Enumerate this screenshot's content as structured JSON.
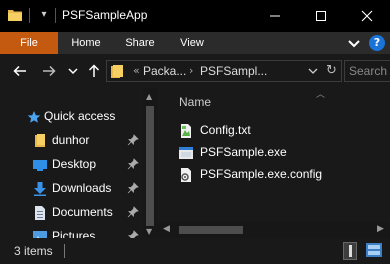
{
  "window": {
    "title": "PSFSampleApp",
    "minimize_icon": "minimize-icon",
    "maximize_icon": "maximize-icon",
    "close_icon": "close-icon"
  },
  "ribbon": {
    "tabs": [
      "File",
      "Home",
      "Share",
      "View"
    ],
    "file_tab_color": "#c45a0f",
    "help_label": "?"
  },
  "navigation": {
    "back_icon": "arrow-left-icon",
    "forward_icon": "arrow-right-icon",
    "recent_icon": "chevron-down-icon",
    "up_icon": "arrow-up-icon"
  },
  "address": {
    "overflow": "«",
    "crumbs": [
      "Packa...",
      "PSFSampl..."
    ],
    "separator": "›"
  },
  "search": {
    "placeholder": "Search"
  },
  "sidebar": {
    "items": [
      {
        "label": "Quick access",
        "icon": "star-icon"
      },
      {
        "label": "dunhor",
        "icon": "folder-icon",
        "pinned": true
      },
      {
        "label": "Desktop",
        "icon": "desktop-icon",
        "pinned": true
      },
      {
        "label": "Downloads",
        "icon": "download-icon",
        "pinned": true
      },
      {
        "label": "Documents",
        "icon": "document-icon",
        "pinned": true
      },
      {
        "label": "Pictures",
        "icon": "pictures-icon",
        "pinned": true
      }
    ]
  },
  "content": {
    "column_header": "Name",
    "files": [
      {
        "name": "Config.txt",
        "icon": "text-file-icon"
      },
      {
        "name": "PSFSample.exe",
        "icon": "exe-file-icon"
      },
      {
        "name": "PSFSample.exe.config",
        "icon": "config-file-icon"
      }
    ]
  },
  "status": {
    "item_count": "3 items"
  },
  "colors": {
    "accent": "#1a73d9",
    "background": "#191919",
    "titlebar": "#000000"
  }
}
